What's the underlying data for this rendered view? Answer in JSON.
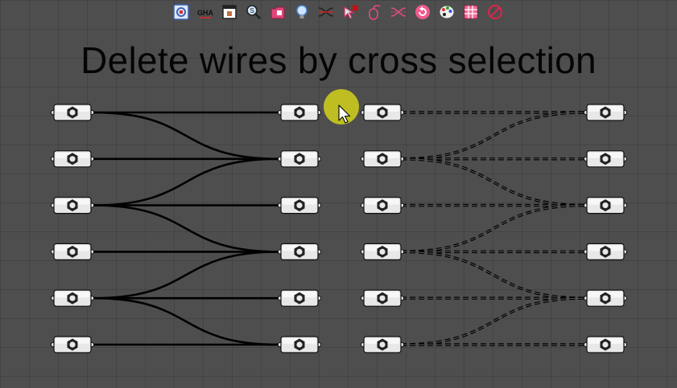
{
  "title": "Delete wires by cross selection",
  "colors": {
    "canvas": "#4e4e4e",
    "wire": "#000000",
    "node_body": "#e8e8e8",
    "cursor_highlight": "#c8c81e"
  },
  "toolbar": {
    "icons": [
      {
        "name": "data-viewer-icon"
      },
      {
        "name": "gha-icon",
        "label": "GHA"
      },
      {
        "name": "window-icon"
      },
      {
        "name": "zoom-search-icon"
      },
      {
        "name": "folder-tag-icon"
      },
      {
        "name": "bulb-icon"
      },
      {
        "name": "wire-cross-icon"
      },
      {
        "name": "cursor-delete-icon"
      },
      {
        "name": "mouse-icon"
      },
      {
        "name": "wire-split-icon"
      },
      {
        "name": "refresh-circle-icon"
      },
      {
        "name": "palette-icon"
      },
      {
        "name": "grid-table-icon"
      },
      {
        "name": "disable-icon"
      }
    ]
  },
  "groups": [
    {
      "name": "left-group",
      "wire_style": "solid",
      "rows": 6,
      "connections": [
        [
          0,
          0
        ],
        [
          0,
          1
        ],
        [
          1,
          1
        ],
        [
          2,
          1
        ],
        [
          2,
          2
        ],
        [
          2,
          3
        ],
        [
          3,
          3
        ],
        [
          4,
          3
        ],
        [
          4,
          4
        ],
        [
          4,
          5
        ],
        [
          5,
          5
        ]
      ]
    },
    {
      "name": "right-group",
      "wire_style": "dashed",
      "rows": 6,
      "connections": [
        [
          0,
          0
        ],
        [
          1,
          0
        ],
        [
          1,
          1
        ],
        [
          1,
          2
        ],
        [
          2,
          2
        ],
        [
          3,
          2
        ],
        [
          3,
          3
        ],
        [
          3,
          4
        ],
        [
          4,
          4
        ],
        [
          5,
          4
        ],
        [
          5,
          5
        ]
      ]
    }
  ]
}
